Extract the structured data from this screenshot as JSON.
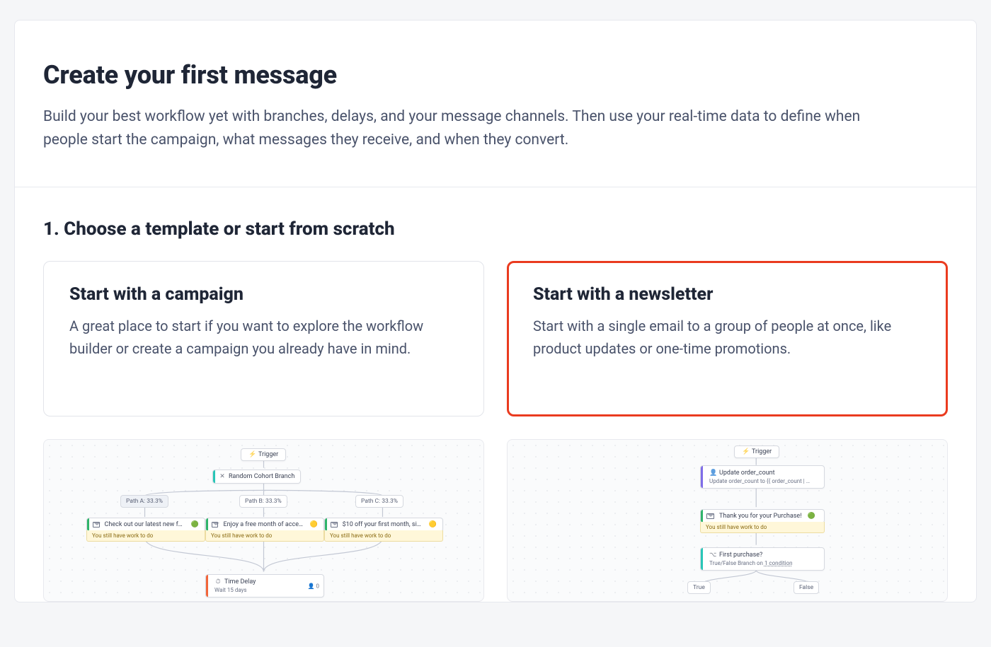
{
  "header": {
    "title": "Create your first message",
    "description": "Build your best workflow yet with branches, delays, and your message channels. Then use your real-time data to define when people start the campaign, what messages they receive, and when they convert."
  },
  "section": {
    "title": "1. Choose a template or start from scratch"
  },
  "options": {
    "campaign": {
      "title": "Start with a campaign",
      "description": "A great place to start if you want to explore the workflow builder or create a campaign you already have in mind."
    },
    "newsletter": {
      "title": "Start with a newsletter",
      "description": "Start with a single email to a group of people at once, like product updates or one-time promotions."
    }
  },
  "workflow_left": {
    "trigger": "Trigger",
    "branch": "Random Cohort Branch",
    "paths": {
      "a": "Path A: 33.3%",
      "b": "Path B: 33.3%",
      "c": "Path C: 33.3%"
    },
    "emails": {
      "a": "Check out our latest new features!",
      "b": "Enjoy a free month of access, on …",
      "c": "$10 off your first month, sign up …"
    },
    "work_to_do": "You still have work to do",
    "delay_title": "Time Delay",
    "delay_sub": "Wait 15 days",
    "delay_count": "0"
  },
  "workflow_right": {
    "trigger": "Trigger",
    "update_title": "Update order_count",
    "update_sub": "Update order_count to {{ order_count | …",
    "thank_you": "Thank you for your Purchase!",
    "work_to_do": "You still have work to do",
    "first_purchase_title": "First purchase?",
    "first_purchase_sub": "True/False Branch on 1 condition",
    "true_label": "True",
    "false_label": "False"
  }
}
